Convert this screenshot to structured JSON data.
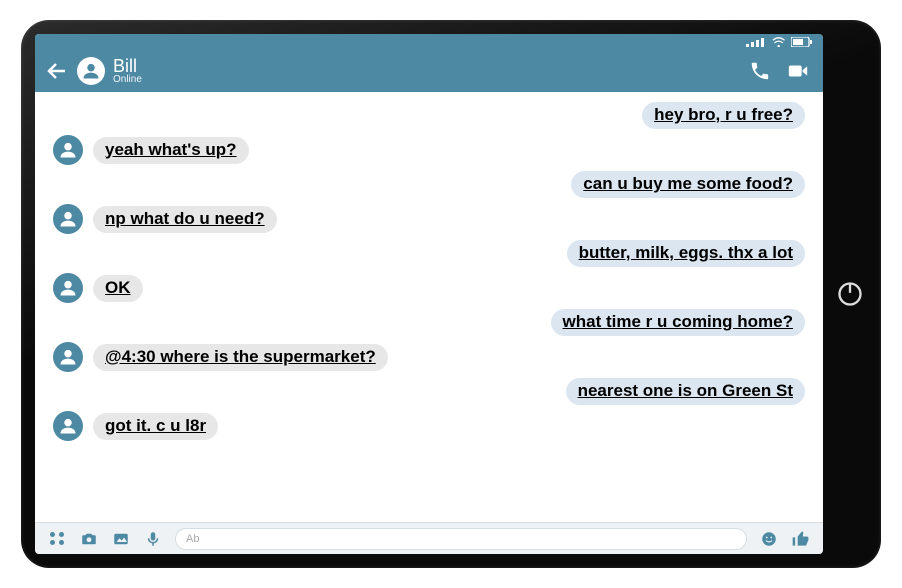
{
  "header": {
    "contact_name": "Bill",
    "status": "Online"
  },
  "messages": [
    {
      "side": "sent",
      "text": "hey bro, r u free?"
    },
    {
      "side": "recv",
      "text": "yeah what's up?"
    },
    {
      "side": "sent",
      "text": "can u buy me some food?"
    },
    {
      "side": "recv",
      "text": "np what do u need?"
    },
    {
      "side": "sent",
      "text": "butter, milk, eggs. thx a lot"
    },
    {
      "side": "recv",
      "text": "OK"
    },
    {
      "side": "sent",
      "text": "what time r u coming home?"
    },
    {
      "side": "recv",
      "text": "@4:30 where is the supermarket?"
    },
    {
      "side": "sent",
      "text": "nearest one is on Green St"
    },
    {
      "side": "recv",
      "text": "got it. c u l8r"
    }
  ],
  "input": {
    "placeholder": "Ab"
  },
  "colors": {
    "accent": "#4e89a4"
  }
}
